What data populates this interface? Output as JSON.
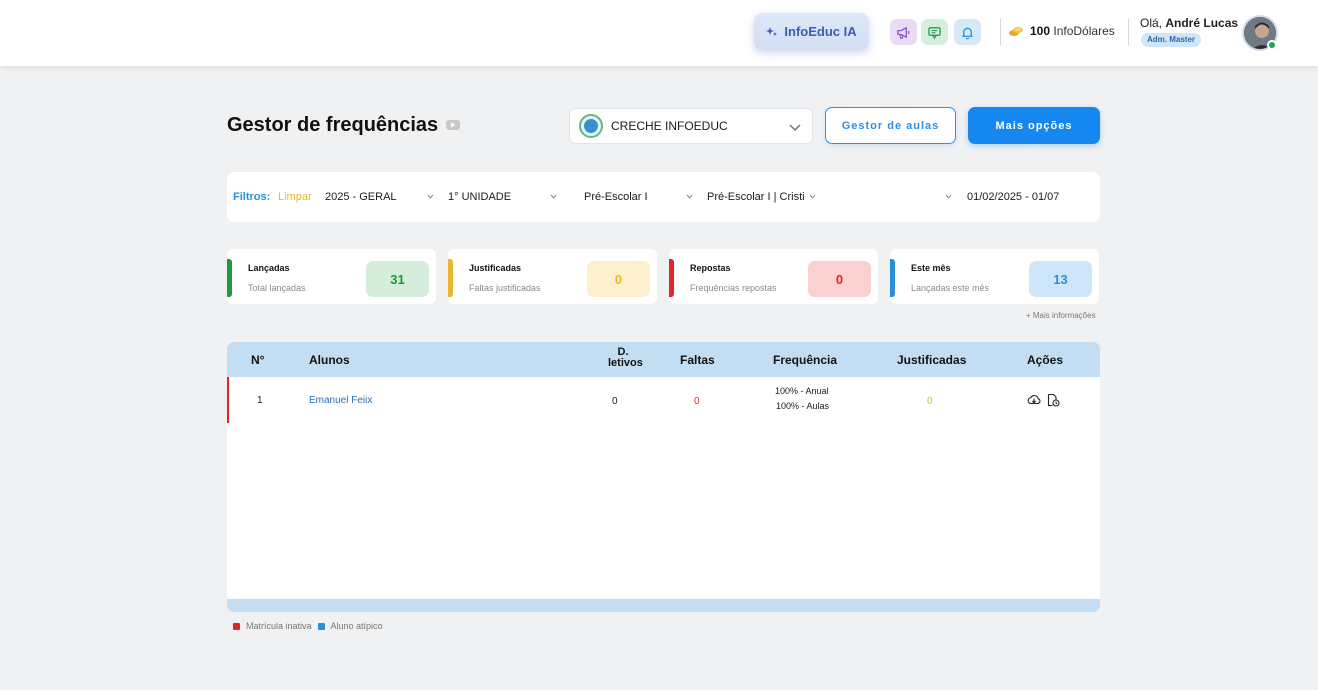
{
  "header": {
    "ia_button_label": "InfoEduc IA",
    "coins_amount": "100",
    "coins_label": "InfoDólares",
    "greeting": "Olá,",
    "user_name": "André Lucas",
    "user_role": "Adm. Master",
    "icons": [
      "megaphone-icon",
      "chat-icon",
      "bell-icon",
      "coins-icon"
    ]
  },
  "page": {
    "title": "Gestor de frequências",
    "school_select_value": "CRECHE INFOEDUC",
    "btn_gestor_aulas": "Gestor de aulas",
    "btn_mais_opcoes": "Mais opções"
  },
  "filters": {
    "label": "Filtros:",
    "clear": "Limpar",
    "year": "2025 - GERAL",
    "unit": "1° UNIDADE",
    "level": "Pré-Escolar I",
    "class": "Pré-Escolar I | Cristi",
    "date_range": "01/02/2025 - 01/07"
  },
  "stats": [
    {
      "title": "Lançadas",
      "subtitle": "Total lançadas",
      "value": "31",
      "color": "#1f9a3a",
      "bg": "#d4eedb"
    },
    {
      "title": "Justificadas",
      "subtitle": "Faltas justificadas",
      "value": "0",
      "color": "#e8b630",
      "bg": "#fdf0cc"
    },
    {
      "title": "Repostas",
      "subtitle": "Frequências repostas",
      "value": "0",
      "color": "#e0262b",
      "bg": "#fbd0d1"
    },
    {
      "title": "Este mês",
      "subtitle": "Lançadas este mês",
      "value": "13",
      "color": "#2b8fd6",
      "bg": "#cfe6f8"
    }
  ],
  "more_info": "+ Mais informações",
  "table": {
    "headers": {
      "num": "N°",
      "alunos": "Alunos",
      "dias_a": "D.",
      "dias_b": "letivos",
      "faltas": "Faltas",
      "frequencia": "Frequência",
      "justificadas": "Justificadas",
      "acoes": "Ações"
    },
    "rows": [
      {
        "num": "1",
        "name": "Emanuel Feiix",
        "dias_letivos": "0",
        "faltas": "0",
        "freq_anual": "100% - Anual",
        "freq_aulas": "100% - Aulas",
        "justificadas": "0"
      }
    ]
  },
  "legend": {
    "inactive": "Matrícula inativa",
    "atypical": "Aluno atípico"
  }
}
